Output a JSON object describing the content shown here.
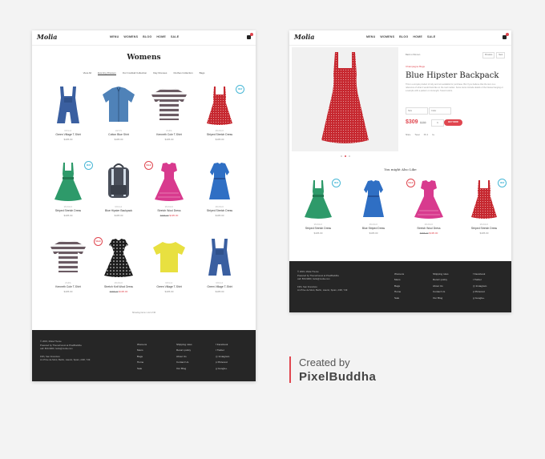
{
  "nav": {
    "logo": "Molia",
    "menu": [
      "MENU",
      "WOMENS",
      "BLOG",
      "HOME",
      "SALE"
    ]
  },
  "catalog": {
    "title": "Womens",
    "filters": [
      "View All",
      "Evening Dresses",
      "Our Cocktail Collection",
      "Day Dresses",
      "Clothes Collection",
      "Bags"
    ],
    "active_filter": 1,
    "products": [
      {
        "brand": "MOLIA",
        "name": "Green Village T-Shirt",
        "price": "$195.00",
        "old": "",
        "badge": "",
        "icon": "overalls-blue-icon"
      },
      {
        "brand": "LEVIS",
        "name": "Cotton Blue Shirt",
        "price": "$195.00",
        "old": "",
        "badge": "",
        "icon": "denim-shirt-icon"
      },
      {
        "brand": "ZARA",
        "name": "Kenneth Cole T-Shirt",
        "price": "$195.00",
        "old": "",
        "badge": "",
        "icon": "striped-tshirt-icon"
      },
      {
        "brand": "MANGO",
        "name": "Striped Stretch Dress",
        "price": "$195.00",
        "old": "",
        "badge": "NEW",
        "icon": "red-dotted-dress-icon"
      },
      {
        "brand": "MANGO",
        "name": "Striped Stretch Dress",
        "price": "$195.00",
        "old": "",
        "badge": "NEW",
        "icon": "green-dress-icon"
      },
      {
        "brand": "MOLIA",
        "name": "Blue Hipster Backpack",
        "price": "$195.00",
        "old": "",
        "badge": "",
        "icon": "backpack-icon"
      },
      {
        "brand": "MANGO",
        "name": "Stretch Wool Dress",
        "price": "$195.00",
        "old": "$385.00",
        "badge": "SALE",
        "icon": "pink-dress-icon"
      },
      {
        "brand": "MANGO",
        "name": "Striped Stretch Dress",
        "price": "$195.00",
        "old": "",
        "badge": "",
        "icon": "blue-dress-icon"
      },
      {
        "brand": "ZARA",
        "name": "Kenneth Cole T-Shirt",
        "price": "$195.00",
        "old": "",
        "badge": "",
        "icon": "striped-tshirt-icon"
      },
      {
        "brand": "MANGO",
        "name": "Stretch Knit Wool Dress",
        "price": "$195.00",
        "old": "$385.00",
        "badge": "SALE",
        "icon": "polka-dress-icon"
      },
      {
        "brand": "MOLIA",
        "name": "Green Village T-Shirt",
        "price": "$195.00",
        "old": "",
        "badge": "",
        "icon": "yellow-tshirt-icon"
      },
      {
        "brand": "MOLIA",
        "name": "Green Village T-Shirt",
        "price": "$195.00",
        "old": "",
        "badge": "",
        "icon": "overalls-blue-icon"
      }
    ],
    "showing": "Showing items 1-12 of 36"
  },
  "product": {
    "breadcrumb": "Back to Women",
    "pager": [
      "Previous",
      "Next"
    ],
    "category": "Champagne Bags",
    "title": "Blue Hipster Backpack",
    "description": "This is a simple product of why and not available for purchase. But If you believe that the item is a reference of what it would look like on the real market. Some items include details of the Nessa hanging or a sample with a pattern on its length, Tweed colors.",
    "size_placeholder": "Size",
    "color_placeholder": "Color",
    "price": "$309",
    "old_price": "$799",
    "qty": "1",
    "buy_label": "BUY NOW",
    "share": [
      "Share",
      "Tweet",
      "Pin it",
      "G+"
    ],
    "might_like_title": "You might Also Like",
    "related": [
      {
        "brand": "MANGO",
        "name": "Striped Stretch Dress",
        "price": "$195.00",
        "old": "",
        "badge": "NEW",
        "icon": "green-dress-icon"
      },
      {
        "brand": "MANGO",
        "name": "Blue Striped Dress",
        "price": "$195.00",
        "old": "",
        "badge": "",
        "icon": "blue-dress-icon"
      },
      {
        "brand": "MANGO",
        "name": "Stretch Wool Dress",
        "price": "$195.00",
        "old": "$385.00",
        "badge": "SALE",
        "icon": "pink-dress-icon"
      },
      {
        "brand": "MANGO",
        "name": "Striped Stretch Dress",
        "price": "$195.00",
        "old": "",
        "badge": "NEW",
        "icon": "red-dotted-dress-icon"
      }
    ]
  },
  "footer": {
    "copy": [
      "© 2015, Molia Theme",
      "Powered by ThemeForest at PixelBuddha"
    ],
    "email": "call: 800-9900, hello@molia.com",
    "address": [
      "Fifth, San Francisco",
      "An Prive de Mont, Berlin, Liaurst, Spain, 2/48, Y49"
    ],
    "col1": [
      "Womens",
      "Mens",
      "Bags",
      "Home",
      "Sale"
    ],
    "col2": [
      "Shipping rules",
      "Return policy",
      "About Us",
      "Contact Us",
      "Our Blog"
    ],
    "col3": [
      "Facebook",
      "Twitter",
      "Instagram",
      "Pinterest",
      "Google+"
    ]
  },
  "credit": {
    "line1": "Created by",
    "line2": "PixelBuddha"
  },
  "colors": {
    "accent": "#e0464f",
    "badge_new": "#48b7d6",
    "footer_bg": "#262626"
  }
}
